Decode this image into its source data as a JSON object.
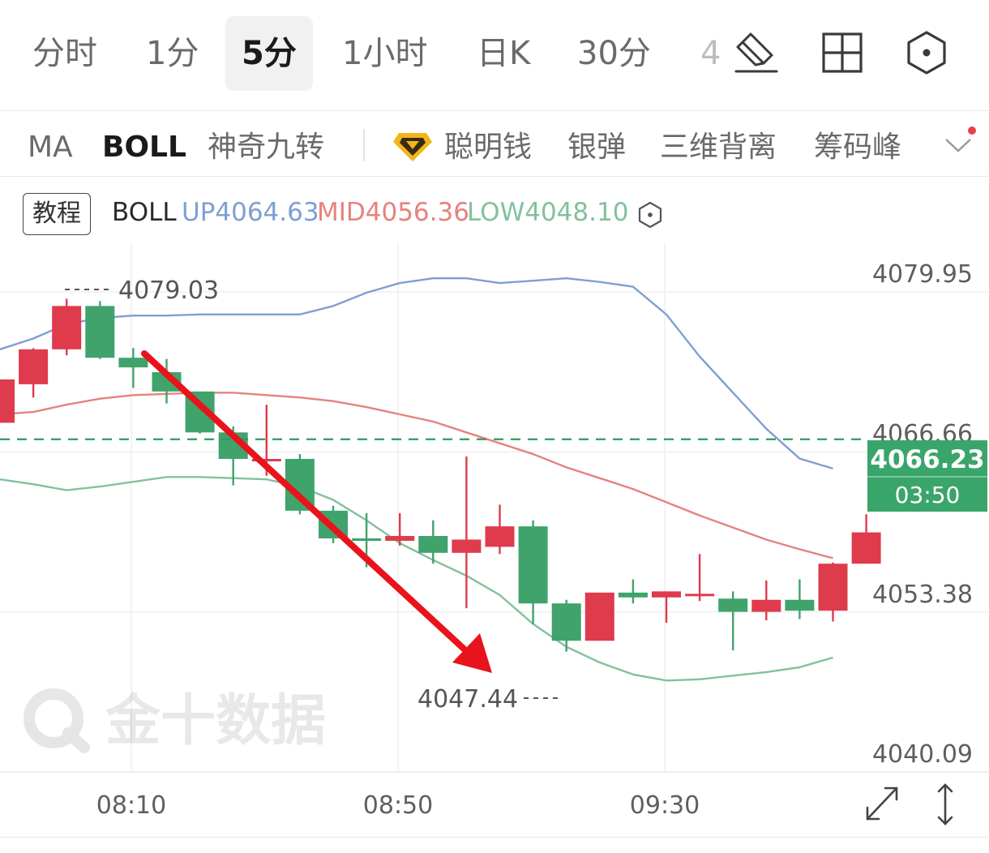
{
  "timeframes": [
    {
      "label": "分时",
      "active": false
    },
    {
      "label": "1分",
      "active": false
    },
    {
      "label": "5分",
      "active": true
    },
    {
      "label": "1小时",
      "active": false
    },
    {
      "label": "日K",
      "active": false
    },
    {
      "label": "30分",
      "active": false
    },
    {
      "label": "4",
      "active": false
    }
  ],
  "toolbar_icons": [
    "drawing-pen-icon",
    "layout-grid-icon",
    "settings-hexagon-icon"
  ],
  "indicators": [
    {
      "label": "MA",
      "active": false
    },
    {
      "label": "BOLL",
      "active": true
    },
    {
      "label": "神奇九转",
      "active": false
    },
    {
      "label": "聪明钱",
      "active": false,
      "icon": "diamond-icon"
    },
    {
      "label": "银弹",
      "active": false
    },
    {
      "label": "三维背离",
      "active": false
    },
    {
      "label": "筹码峰",
      "active": false
    }
  ],
  "legend": {
    "tutorial_label": "教程",
    "name": "BOLL",
    "up_label": "UP4064.63",
    "mid_label": "MID4056.36",
    "low_label": "LOW4048.10"
  },
  "colors": {
    "up_candle": "#de3b4c",
    "down_candle": "#3fa36b",
    "boll_up": "#7f9ed4",
    "boll_mid": "#e5837c",
    "boll_low": "#82c19c",
    "current_price": "#2f9a5e",
    "arrow": "#e8141c"
  },
  "watermark": "金十数据",
  "chart_data": {
    "type": "candlestick",
    "title": "",
    "ylim": [
      4040.09,
      4079.95
    ],
    "y_ticks": [
      "4079.95",
      "4066.66",
      "4053.38",
      "4040.09"
    ],
    "x_ticks": [
      "08:10",
      "08:50",
      "09:30"
    ],
    "high_marker": "4079.03",
    "low_marker": "4047.44",
    "current_price": "4066.23",
    "countdown": "03:50",
    "candles": [
      {
        "o": 4067.6,
        "h": 4071.2,
        "l": 4067.6,
        "c": 4071.2
      },
      {
        "o": 4070.8,
        "h": 4073.8,
        "l": 4069.7,
        "c": 4073.7
      },
      {
        "o": 4073.7,
        "h": 4077.9,
        "l": 4073.2,
        "c": 4077.3
      },
      {
        "o": 4077.3,
        "h": 4077.7,
        "l": 4072.9,
        "c": 4073.0
      },
      {
        "o": 4073.0,
        "h": 4073.8,
        "l": 4070.5,
        "c": 4072.2
      },
      {
        "o": 4071.8,
        "h": 4072.9,
        "l": 4069.2,
        "c": 4070.2
      },
      {
        "o": 4070.2,
        "h": 4070.2,
        "l": 4066.7,
        "c": 4066.8
      },
      {
        "o": 4066.8,
        "h": 4067.3,
        "l": 4062.4,
        "c": 4064.6
      },
      {
        "o": 4064.6,
        "h": 4069.1,
        "l": 4063.2,
        "c": 4064.6
      },
      {
        "o": 4064.6,
        "h": 4065.0,
        "l": 4060.0,
        "c": 4060.3
      },
      {
        "o": 4060.3,
        "h": 4060.7,
        "l": 4057.6,
        "c": 4058.0
      },
      {
        "o": 4058.0,
        "h": 4060.1,
        "l": 4055.6,
        "c": 4057.8
      },
      {
        "o": 4057.8,
        "h": 4060.1,
        "l": 4057.4,
        "c": 4058.2
      },
      {
        "o": 4058.2,
        "h": 4059.5,
        "l": 4055.9,
        "c": 4056.8
      },
      {
        "o": 4056.8,
        "h": 4064.8,
        "l": 4052.2,
        "c": 4057.9
      },
      {
        "o": 4057.3,
        "h": 4060.8,
        "l": 4056.7,
        "c": 4059.0
      },
      {
        "o": 4059.0,
        "h": 4059.5,
        "l": 4050.9,
        "c": 4052.6
      },
      {
        "o": 4052.6,
        "h": 4052.9,
        "l": 4048.6,
        "c": 4049.5
      },
      {
        "o": 4049.5,
        "h": 4053.5,
        "l": 4049.5,
        "c": 4053.5
      },
      {
        "o": 4053.5,
        "h": 4054.6,
        "l": 4052.6,
        "c": 4053.1
      },
      {
        "o": 4053.1,
        "h": 4053.6,
        "l": 4051.0,
        "c": 4053.6
      },
      {
        "o": 4053.4,
        "h": 4056.7,
        "l": 4052.8,
        "c": 4053.4
      },
      {
        "o": 4053.0,
        "h": 4053.6,
        "l": 4048.7,
        "c": 4051.9
      },
      {
        "o": 4051.9,
        "h": 4054.5,
        "l": 4051.2,
        "c": 4052.9
      },
      {
        "o": 4052.9,
        "h": 4054.6,
        "l": 4051.3,
        "c": 4052.0
      },
      {
        "o": 4052.0,
        "h": 4056.0,
        "l": 4051.1,
        "c": 4055.9
      },
      {
        "o": 4055.9,
        "h": 4060.0,
        "l": 4055.9,
        "c": 4058.5
      }
    ],
    "boll_up": [
      4073.7,
      4074.6,
      4075.8,
      4076.3,
      4076.5,
      4076.5,
      4076.6,
      4076.6,
      4076.6,
      4076.6,
      4077.3,
      4078.4,
      4079.2,
      4079.6,
      4079.6,
      4079.2,
      4079.4,
      4079.6,
      4079.3,
      4078.9,
      4076.6,
      4073.1,
      4070.1,
      4067.1,
      4064.63,
      4063.8
    ],
    "boll_mid": [
      4068.3,
      4068.5,
      4069.1,
      4069.6,
      4069.9,
      4070.0,
      4070.1,
      4070.1,
      4069.9,
      4069.7,
      4069.4,
      4068.9,
      4068.3,
      4067.7,
      4066.8,
      4065.9,
      4065.0,
      4063.9,
      4063.0,
      4062.1,
      4061.0,
      4059.9,
      4058.9,
      4057.9,
      4057.1,
      4056.36
    ],
    "boll_low": [
      4062.9,
      4062.5,
      4062.0,
      4062.3,
      4062.7,
      4063.1,
      4063.1,
      4063.0,
      4062.9,
      4062.3,
      4061.2,
      4059.5,
      4057.6,
      4056.2,
      4054.9,
      4053.3,
      4050.9,
      4049.0,
      4047.7,
      4046.7,
      4046.2,
      4046.3,
      4046.6,
      4046.9,
      4047.3,
      4048.1
    ],
    "annotation": "downward trend arrow"
  }
}
